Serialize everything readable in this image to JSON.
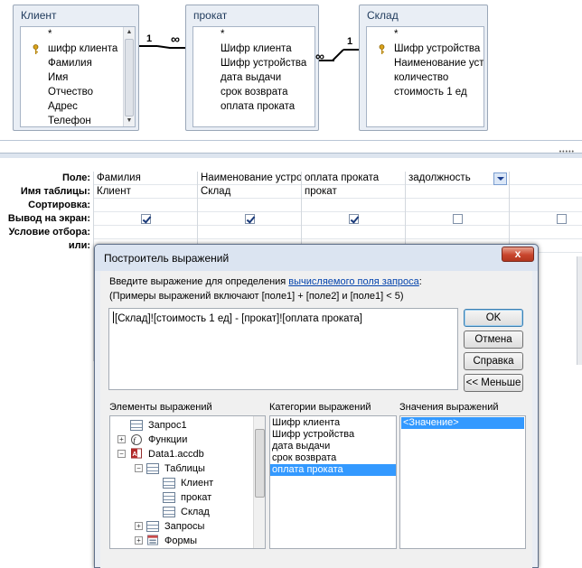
{
  "design": {
    "tables": [
      {
        "title": "Клиент",
        "fields": [
          "*",
          "шифр клиента",
          "Фамилия",
          "Имя",
          "Отчество",
          "Адрес",
          "Телефон"
        ]
      },
      {
        "title": "прокат",
        "fields": [
          "*",
          "Шифр клиента",
          "Шифр устройства",
          "дата выдачи",
          "срок возврата",
          "оплата проката"
        ]
      },
      {
        "title": "Склад",
        "fields": [
          "*",
          "Шифр устройства",
          "Наименование уст",
          "количество",
          "стоимость 1 ед"
        ]
      }
    ],
    "relations": [
      {
        "one": "1",
        "many": "∞"
      },
      {
        "one": "1",
        "many": "∞"
      }
    ]
  },
  "grid": {
    "row_labels": {
      "field": "Поле:",
      "table": "Имя таблицы:",
      "sort": "Сортировка:",
      "show": "Вывод на экран:",
      "criteria": "Условие отбора:",
      "or": "или:"
    },
    "columns": [
      {
        "field": "Фамилия",
        "table": "Клиент",
        "show": true
      },
      {
        "field": "Наименование устро",
        "table": "Склад",
        "show": true
      },
      {
        "field": "оплата проката",
        "table": "прокат",
        "show": true
      },
      {
        "field": "задолжность",
        "table": "",
        "show": false
      },
      {
        "field": "",
        "table": "",
        "show": false
      }
    ]
  },
  "dialog": {
    "title": "Построитель выражений",
    "close_label": "x",
    "instr_prefix": "Введите выражение для определения ",
    "instr_link": "вычисляемого поля запроса",
    "instr_suffix": ":",
    "examples": "(Примеры выражений включают [поле1] + [поле2] и [поле1] < 5)",
    "expression": "[Склад]![стоимость 1 ед] - [прокат]![оплата проката]",
    "buttons": {
      "ok": "OK",
      "cancel": "Отмена",
      "help": "Справка",
      "less": "<< Меньше"
    },
    "elements_label": "Элементы выражений",
    "categories_label": "Категории выражений",
    "values_label": "Значения выражений",
    "tree": {
      "query1": "Запрос1",
      "functions": "Функции",
      "db": "Data1.accdb",
      "tables": "Таблицы",
      "t1": "Клиент",
      "t2": "прокат",
      "t3": "Склад",
      "queries": "Запросы",
      "forms": "Формы"
    },
    "categories": [
      "Шифр клиента",
      "Шифр устройства",
      "дата выдачи",
      "срок возврата",
      "оплата проката"
    ],
    "selected_category": 4,
    "values": [
      "<Значение>"
    ]
  }
}
